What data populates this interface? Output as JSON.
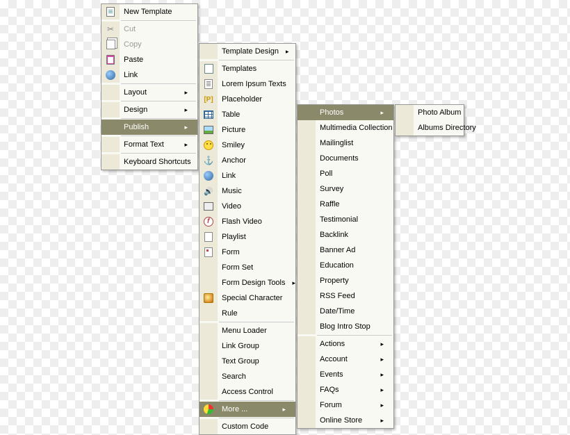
{
  "menu1": {
    "new_template": "New Template",
    "cut": "Cut",
    "copy": "Copy",
    "paste": "Paste",
    "link": "Link",
    "layout": "Layout",
    "design": "Design",
    "publish": "Publish",
    "format_text": "Format Text",
    "keyboard_shortcuts": "Keyboard Shortcuts"
  },
  "menu2": {
    "template_design": "Template Design",
    "templates": "Templates",
    "lorem": "Lorem Ipsum Texts",
    "placeholder": "Placeholder",
    "table": "Table",
    "picture": "Picture",
    "smiley": "Smiley",
    "anchor": "Anchor",
    "link": "Link",
    "music": "Music",
    "video": "Video",
    "flash": "Flash Video",
    "playlist": "Playlist",
    "form": "Form",
    "form_set": "Form Set",
    "form_tools": "Form Design Tools",
    "special": "Special Character",
    "rule": "Rule",
    "menu_loader": "Menu Loader",
    "link_group": "Link Group",
    "text_group": "Text Group",
    "search": "Search",
    "access_control": "Access Control",
    "more": "More ...",
    "custom_code": "Custom Code"
  },
  "menu3": {
    "photos": "Photos",
    "multimedia": "Multimedia Collection",
    "mailinglist": "Mailinglist",
    "documents": "Documents",
    "poll": "Poll",
    "survey": "Survey",
    "raffle": "Raffle",
    "testimonial": "Testimonial",
    "backlink": "Backlink",
    "banner": "Banner Ad",
    "education": "Education",
    "property": "Property",
    "rss": "RSS Feed",
    "datetime": "Date/Time",
    "blog_intro": "Blog Intro Stop",
    "actions": "Actions",
    "account": "Account",
    "events": "Events",
    "faqs": "FAQs",
    "forum": "Forum",
    "online_store": "Online Store"
  },
  "menu4": {
    "photo_album": "Photo Album",
    "albums_dir": "Albums Directory"
  }
}
